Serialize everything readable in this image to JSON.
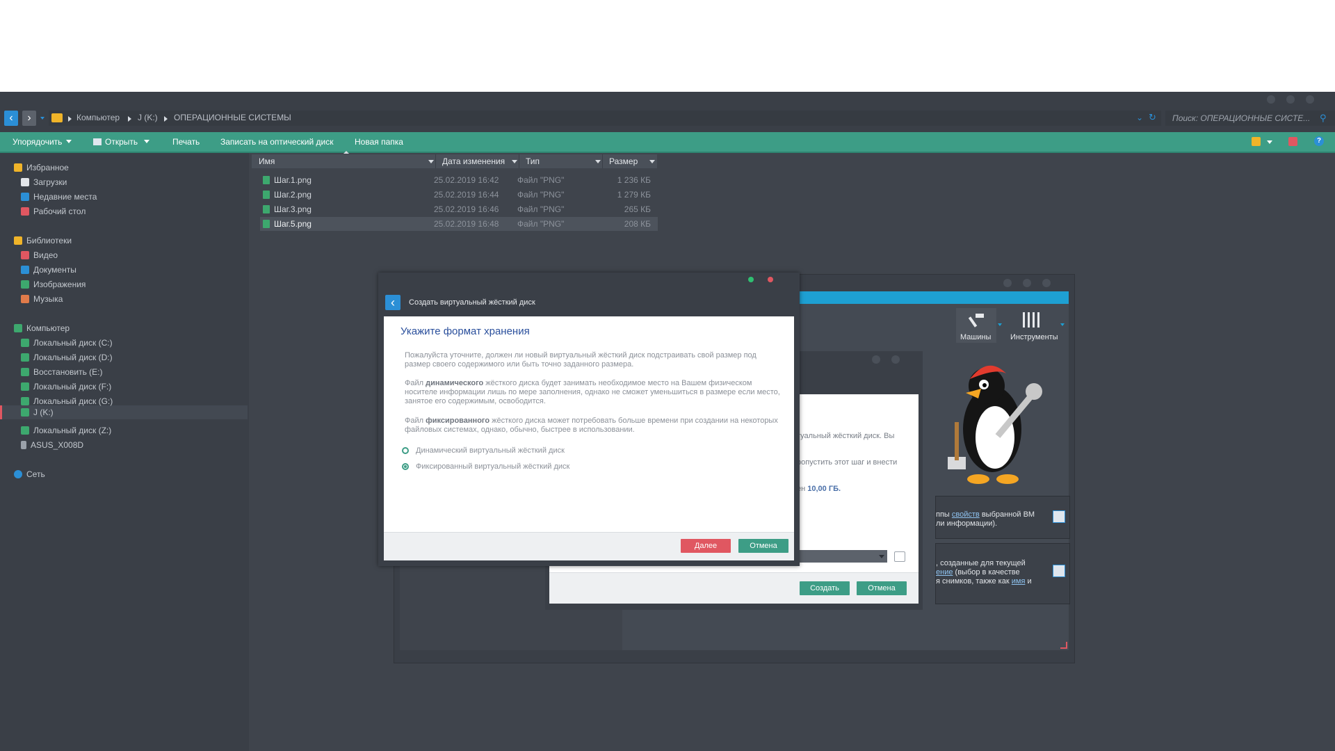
{
  "explorer": {
    "breadcrumb": [
      "Компьютер",
      "J (K:)",
      "ОПЕРАЦИОННЫЕ СИСТЕМЫ"
    ],
    "search_placeholder": "Поиск: ОПЕРАЦИОННЫЕ СИСТЕ...",
    "toolbar": {
      "organize": "Упорядочить",
      "open": "Открыть",
      "print": "Печать",
      "burn": "Записать на оптический диск",
      "new_folder": "Новая папка"
    },
    "sidebar": {
      "favorites": "Избранное",
      "favorites_items": [
        "Загрузки",
        "Недавние места",
        "Рабочий стол"
      ],
      "libraries": "Библиотеки",
      "libraries_items": [
        "Видео",
        "Документы",
        "Изображения",
        "Музыка"
      ],
      "computer": "Компьютер",
      "computer_items": [
        "Локальный диск (C:)",
        "Локальный диск (D:)",
        "Восстановить (E:)",
        "Локальный диск (F:)",
        "Локальный диск (G:)",
        "J (K:)",
        "Локальный диск (Z:)",
        "ASUS_X008D"
      ],
      "network": "Сеть"
    },
    "columns": [
      "Имя",
      "Дата изменения",
      "Тип",
      "Размер"
    ],
    "files": [
      {
        "name": "Шаг.1.png",
        "date": "25.02.2019 16:42",
        "type": "Файл \"PNG\"",
        "size": "1 236 КБ"
      },
      {
        "name": "Шаг.2.png",
        "date": "25.02.2019 16:44",
        "type": "Файл \"PNG\"",
        "size": "1 279 КБ"
      },
      {
        "name": "Шаг.3.png",
        "date": "25.02.2019 16:46",
        "type": "Файл \"PNG\"",
        "size": "265 КБ"
      },
      {
        "name": "Шаг.5.png",
        "date": "25.02.2019 16:48",
        "type": "Файл \"PNG\"",
        "size": "208 КБ"
      }
    ]
  },
  "vbox": {
    "tool_machines": "Машины",
    "tool_tools": "Инструменты",
    "panel1_line1_pre": "ппы ",
    "panel1_line1_link": "свойств",
    "panel1_line1_post": " выбранной ВМ",
    "panel1_line2": "ли информации).",
    "panel2_line1": ", созданные для текущей",
    "panel2_line2_link": "ение",
    "panel2_line2_post": " (выбор в качестве",
    "panel2_line3_pre": "я снимков, также как ",
    "panel2_line3_link": "имя",
    "panel2_line3_post": " и"
  },
  "wizard_back": {
    "line1": "туальный жёсткий диск. Вы",
    "line2": "ропустить этот шаг и внести",
    "line3_pre": "ен ",
    "line3_bold": "10,00 ГБ.",
    "create": "Создать",
    "cancel": "Отмена"
  },
  "dialog": {
    "title": "Создать виртуальный жёсткий диск",
    "heading": "Укажите формат хранения",
    "para1": "Пожалуйста уточните, должен ли новый виртуальный жёсткий диск подстраивать свой размер под размер своего содержимого или быть точно заданного размера.",
    "para2_pre": "Файл ",
    "para2_bold": "динамического",
    "para2_post": " жёсткого диска будет занимать необходимое место на Вашем физическом носителе информации лишь по мере заполнения, однако не сможет уменьшиться в размере если место, занятое его содержимым, освободится.",
    "para3_pre": "Файл ",
    "para3_bold": "фиксированного",
    "para3_post": " жёсткого диска может потребовать больше времени при создании на некоторых файловых системах, однако, обычно, быстрее в использовании.",
    "option_dynamic": "Динамический виртуальный жёсткий диск",
    "option_fixed": "Фиксированный виртуальный жёсткий диск",
    "next": "Далее",
    "cancel": "Отмена"
  },
  "colors": {
    "accent": "#3d9d86",
    "danger": "#e05761",
    "vbox_blue": "#1ea0d3",
    "heading_blue": "#2a4f9c"
  }
}
